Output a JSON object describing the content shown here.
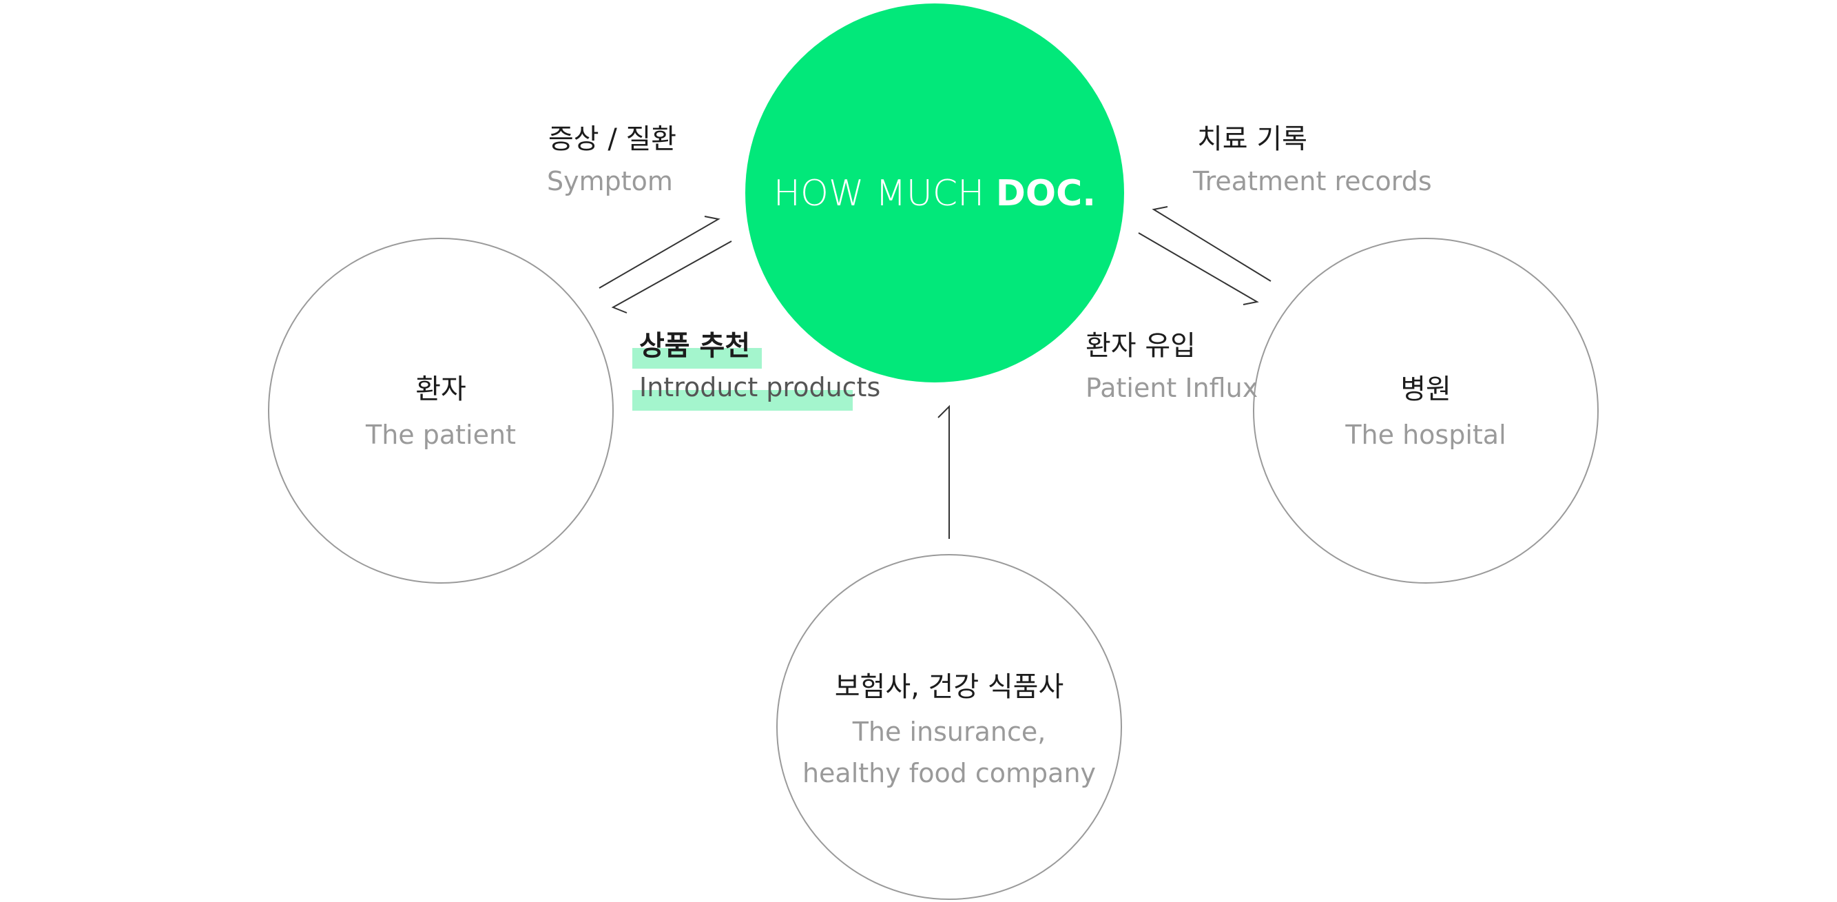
{
  "colors": {
    "brand": "#02e87a",
    "highlight": "#a4f5cd",
    "circle_stroke": "#9a9a9a",
    "arrow_stroke": "#333333",
    "label_dark": "#1c1c1c",
    "label_gray": "#9a9a9a"
  },
  "hub": {
    "name_light": "HOW MUCH ",
    "name_bold": "DOC."
  },
  "nodes": {
    "patient": {
      "ko": "환자",
      "en": "The patient"
    },
    "hospital": {
      "ko": "병원",
      "en": "The hospital"
    },
    "insurance": {
      "ko": "보험사, 건강 식품사",
      "en_line1": "The insurance,",
      "en_line2": "healthy food company"
    }
  },
  "flows": {
    "symptom": {
      "ko": "증상 / 질환",
      "en": "Symptom"
    },
    "products": {
      "ko": "상품 추천",
      "en": "Introduct products"
    },
    "treatment": {
      "ko": "치료 기록",
      "en": "Treatment records"
    },
    "influx": {
      "ko": "환자 유입",
      "en": "Patient Influx"
    }
  }
}
